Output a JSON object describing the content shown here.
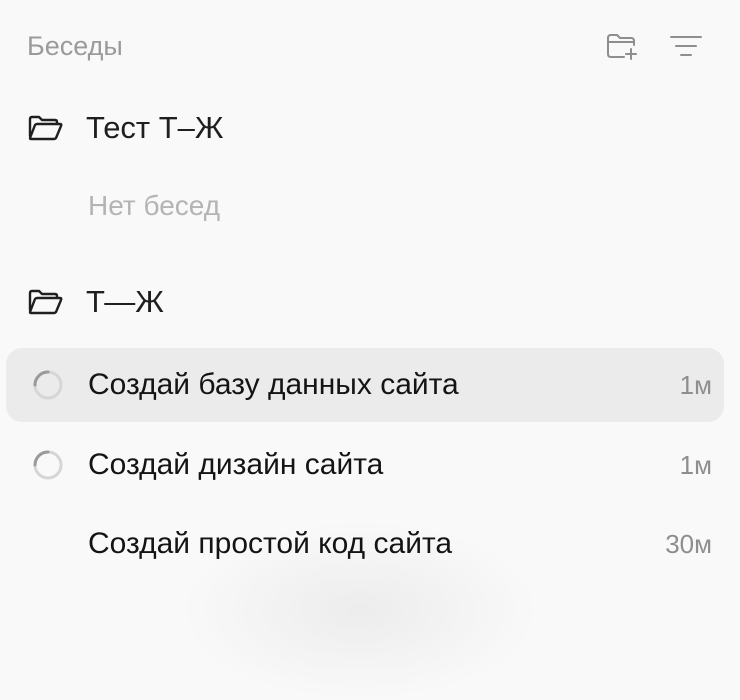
{
  "header": {
    "title": "Беседы",
    "new_folder_icon": "folder-plus-icon",
    "filter_icon": "filter-lines-icon"
  },
  "folders": [
    {
      "name": "Тест Т–Ж",
      "icon": "folder-open-icon",
      "empty_text": "Нет бесед"
    },
    {
      "name": "Т—Ж",
      "icon": "folder-open-icon"
    }
  ],
  "conversations": [
    {
      "title": "Создай базу данных сайта",
      "time": "1м",
      "status_icon": "loading-spinner-icon",
      "selected": true
    },
    {
      "title": "Создай дизайн сайта",
      "time": "1м",
      "status_icon": "loading-spinner-icon",
      "selected": false
    },
    {
      "title": "Создай простой код сайта",
      "time": "30м",
      "status_icon": "",
      "selected": false
    }
  ],
  "colors": {
    "background": "#f9f9f9",
    "selected_row": "#ebebeb",
    "muted_text": "#9b9b9b",
    "primary_text": "#141414"
  }
}
